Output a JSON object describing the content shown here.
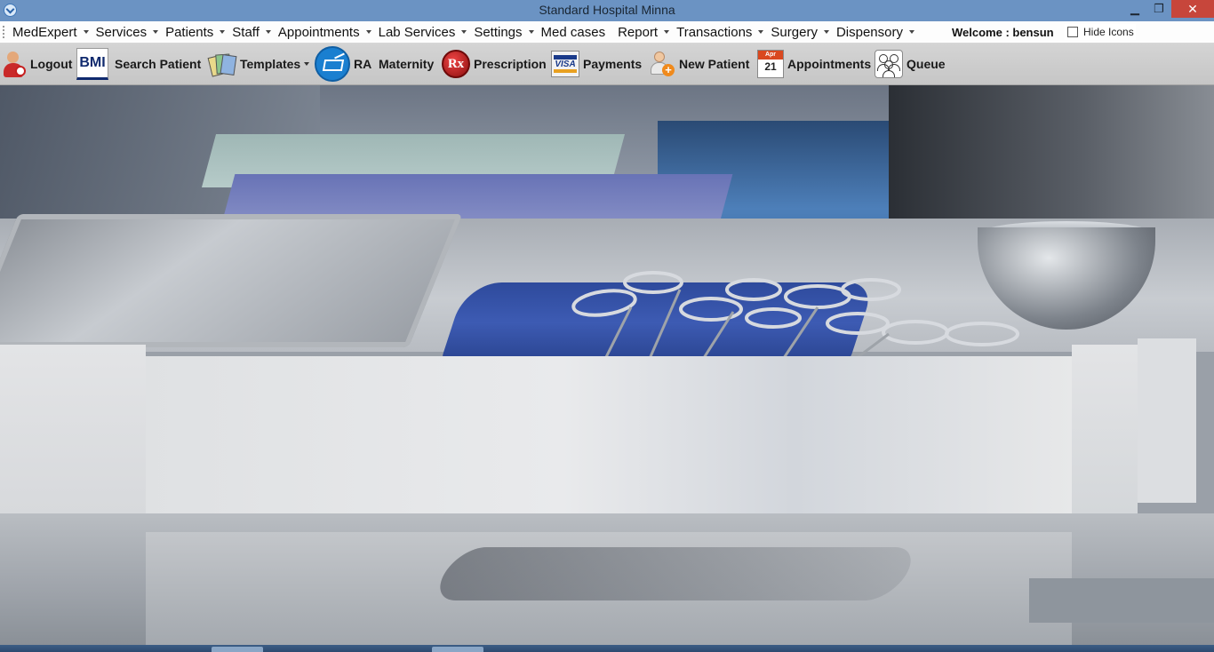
{
  "window": {
    "title": "Standard Hospital Minna",
    "controls": {
      "minimize": "▁",
      "maximize": "❐",
      "close": "✕"
    }
  },
  "menubar": {
    "items": [
      {
        "label": "MedExpert",
        "dropdown": true
      },
      {
        "label": "Services",
        "dropdown": true
      },
      {
        "label": "Patients",
        "dropdown": true
      },
      {
        "label": "Staff",
        "dropdown": true
      },
      {
        "label": "Appointments",
        "dropdown": true
      },
      {
        "label": "Lab Services",
        "dropdown": true
      },
      {
        "label": "Settings",
        "dropdown": true
      },
      {
        "label": "Med cases",
        "dropdown": false
      },
      {
        "label": "Report",
        "dropdown": true
      },
      {
        "label": "Transactions",
        "dropdown": true
      },
      {
        "label": "Surgery",
        "dropdown": true
      },
      {
        "label": "Dispensory",
        "dropdown": true
      }
    ],
    "welcome": "Welcome : bensun",
    "hide_icons_label": "Hide Icons",
    "hide_icons_checked": false
  },
  "toolbar": {
    "logout": "Logout",
    "bmi_icon_text": "BMI",
    "search_patient": "Search Patient",
    "templates": "Templates",
    "ra": "RA",
    "maternity": "Maternity",
    "rx_icon_text": "Rx",
    "prescription": "Prescription",
    "visa_icon_text": "VISA",
    "payments": "Payments",
    "new_patient": "New Patient",
    "calendar_month": "Apr",
    "calendar_day": "21",
    "appointments": "Appointments",
    "queue": "Queue"
  },
  "icons": {
    "logout": "logout-user-icon",
    "bmi": "bmi-icon",
    "templates": "templates-books-icon",
    "ra": "ra-card-icon",
    "prescription": "rx-icon",
    "payments": "visa-card-icon",
    "new_patient": "add-user-icon",
    "appointments": "calendar-icon",
    "queue": "queue-people-icon"
  },
  "colors": {
    "titlebar": "#6b93c3",
    "close_button": "#c7463b",
    "toolbar": "#cccccc",
    "cloth": "#3d5bb3"
  }
}
